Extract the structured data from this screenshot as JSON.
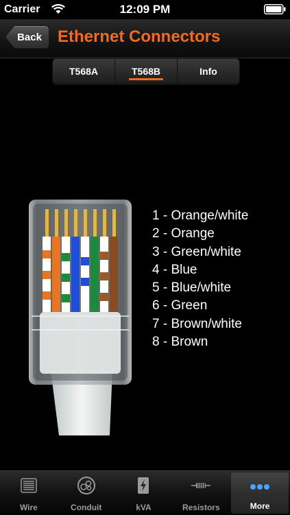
{
  "status": {
    "carrier": "Carrier",
    "time": "12:09 PM"
  },
  "nav": {
    "back_label": "Back",
    "title": "Ethernet Connectors"
  },
  "segments": [
    {
      "label": "T568A",
      "selected": false
    },
    {
      "label": "T568B",
      "selected": true
    },
    {
      "label": "Info",
      "selected": false
    }
  ],
  "pins": [
    "1 - Orange/white",
    "2 - Orange",
    "3 - Green/white",
    "4 - Blue",
    "5 - Blue/white",
    "6 - Green",
    "7 - Brown/white",
    "8 - Brown"
  ],
  "tabs": [
    {
      "label": "Wire",
      "icon": "wire-coil-icon",
      "active": false
    },
    {
      "label": "Conduit",
      "icon": "conduit-icon",
      "active": false
    },
    {
      "label": "kVA",
      "icon": "kva-icon",
      "active": false
    },
    {
      "label": "Resistors",
      "icon": "resistor-icon",
      "active": false
    },
    {
      "label": "More",
      "icon": "more-dots-icon",
      "active": true
    }
  ],
  "colors": {
    "accent": "#f26b1d"
  }
}
